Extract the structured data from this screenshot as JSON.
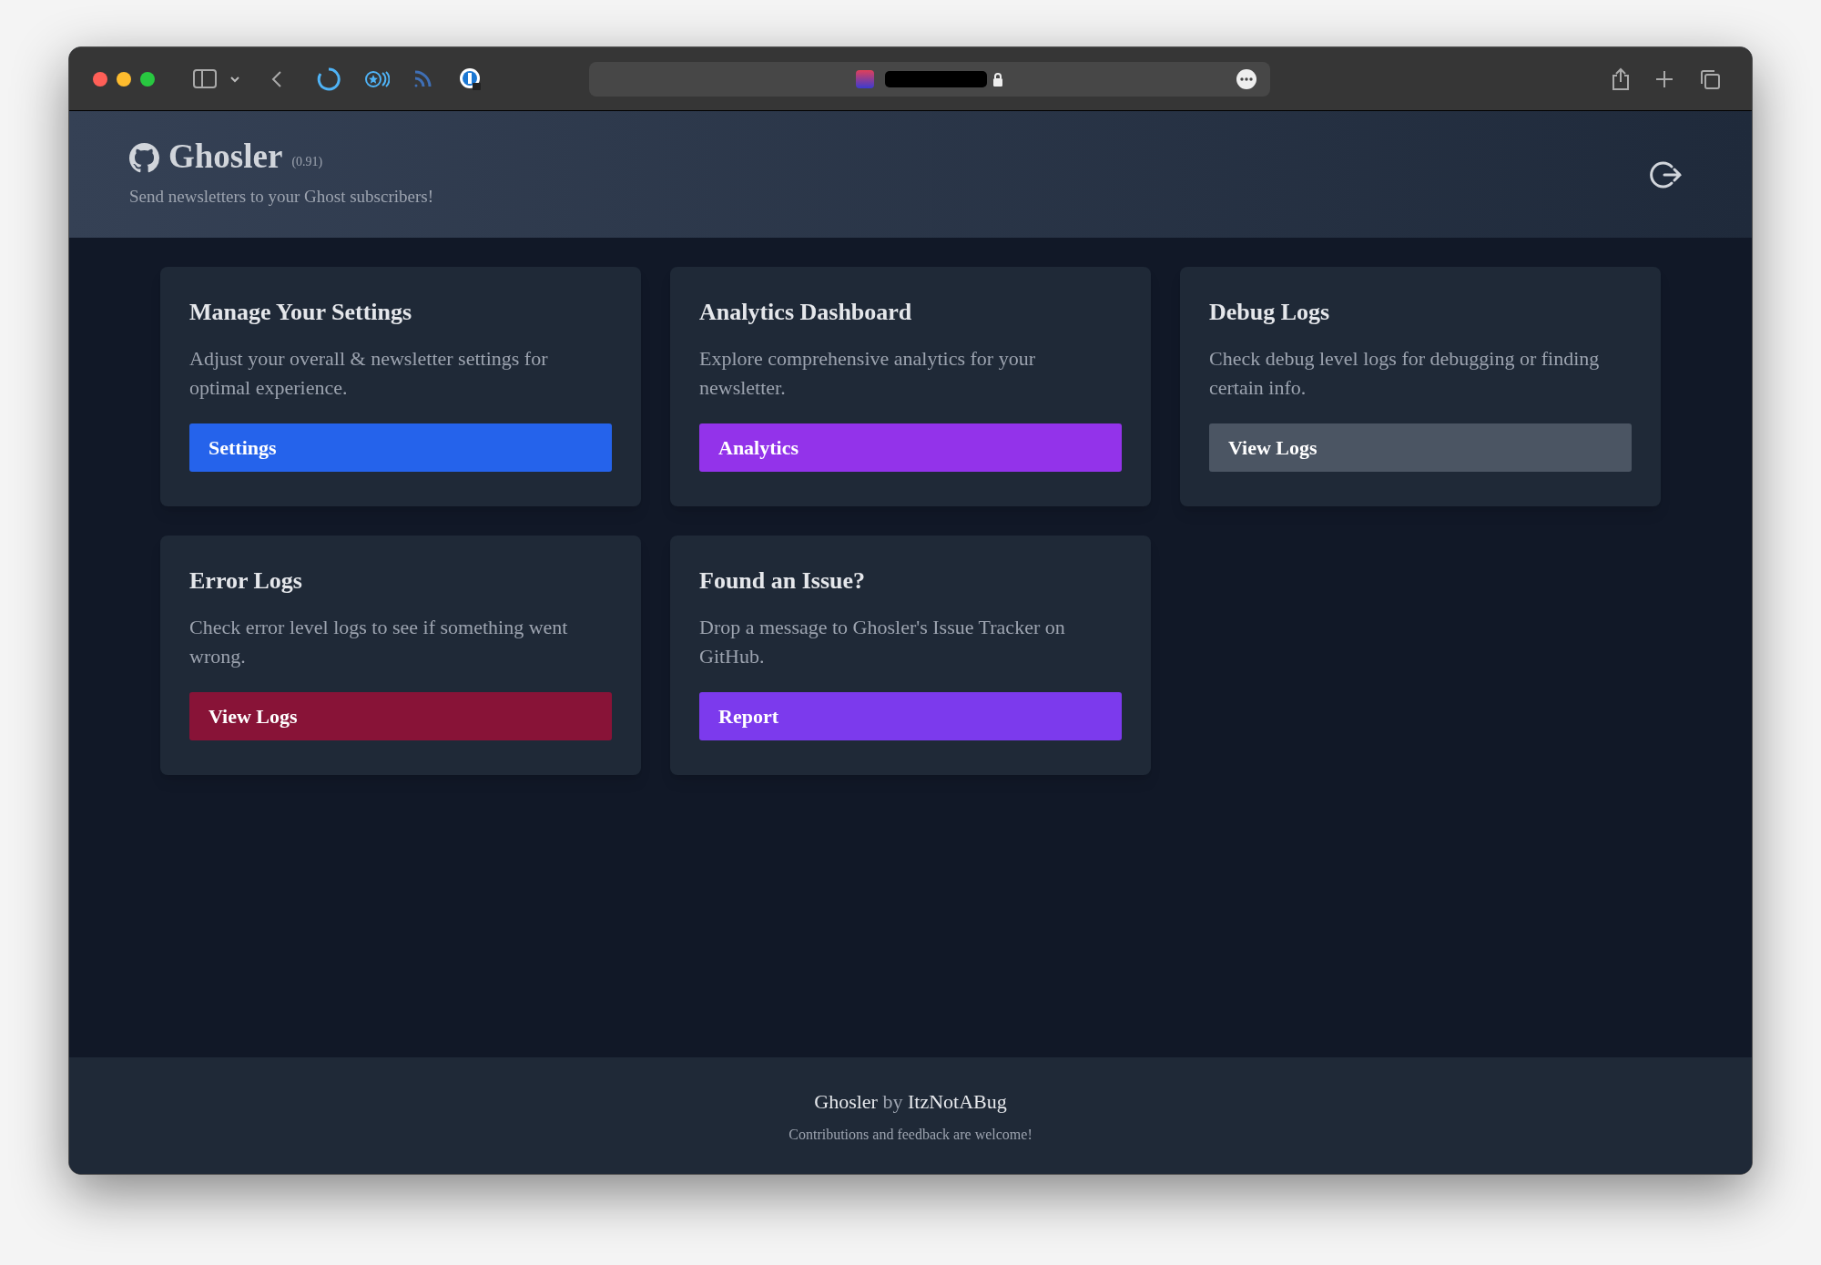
{
  "header": {
    "title": "Ghosler",
    "version": "(0.91)",
    "subtitle": "Send newsletters to your Ghost subscribers!"
  },
  "cards": [
    {
      "title": "Manage Your Settings",
      "description": "Adjust your overall & newsletter settings for optimal experience.",
      "button": "Settings",
      "color": "#2563eb"
    },
    {
      "title": "Analytics Dashboard",
      "description": "Explore comprehensive analytics for your newsletter.",
      "button": "Analytics",
      "color": "#9333ea"
    },
    {
      "title": "Debug Logs",
      "description": "Check debug level logs for debugging or finding certain info.",
      "button": "View Logs",
      "color": "#4b5563"
    },
    {
      "title": "Error Logs",
      "description": "Check error level logs to see if something went wrong.",
      "button": "View Logs",
      "color": "#881337"
    },
    {
      "title": "Found an Issue?",
      "description": "Drop a message to Ghosler's Issue Tracker on GitHub.",
      "button": "Report",
      "color": "#7c3aed"
    }
  ],
  "footer": {
    "credit": [
      "Ghosler",
      "by",
      "ItzNotABug"
    ],
    "note": "Contributions and feedback are welcome!"
  }
}
